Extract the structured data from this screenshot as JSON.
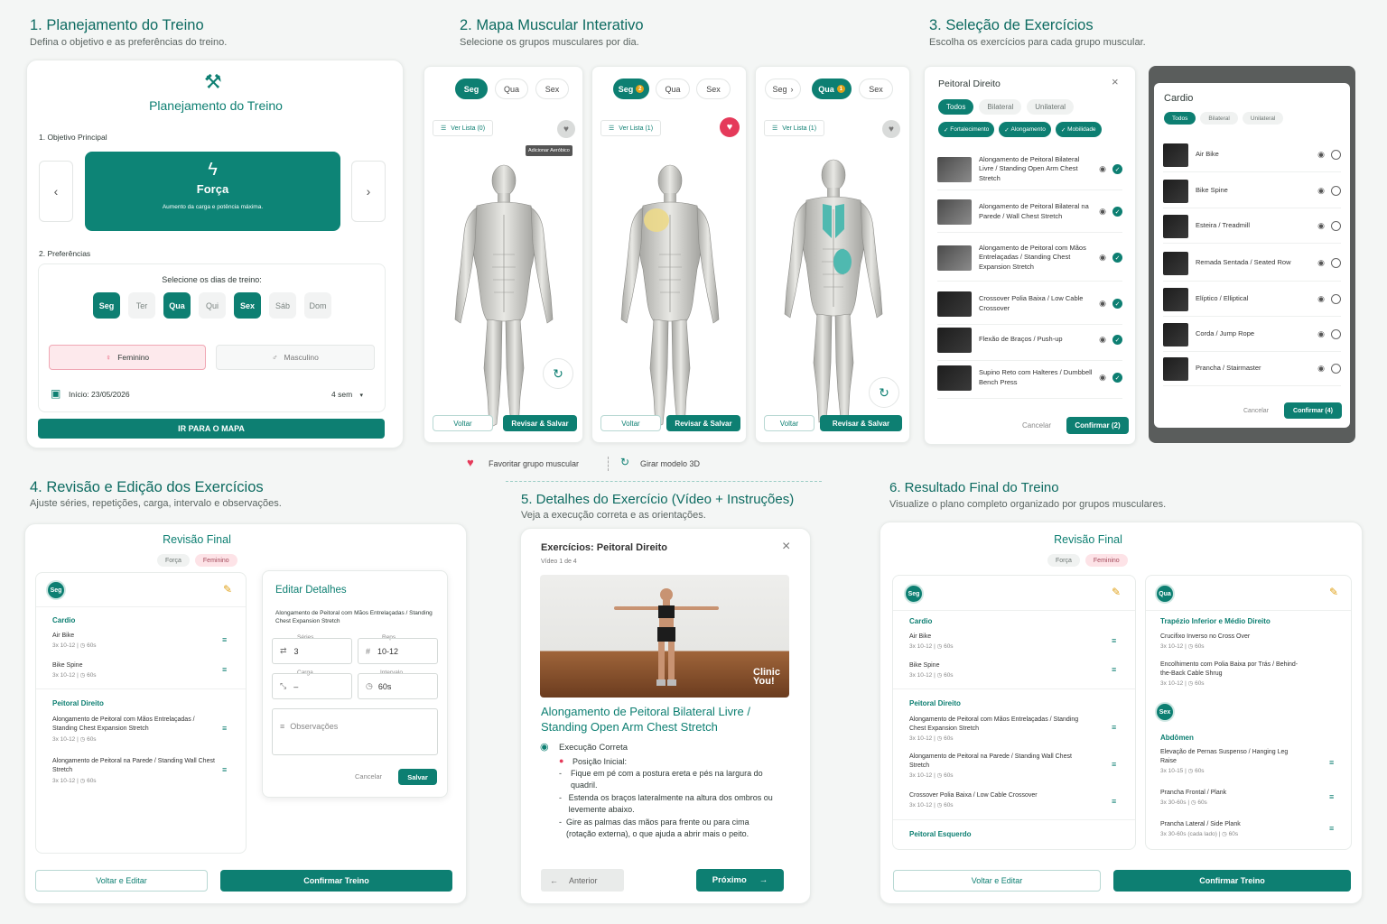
{
  "s1": {
    "title": "1. Planejamento do Treino",
    "sub": "Defina o objetivo e as preferências do treino.",
    "card_title": "Planejamento do Treino",
    "obj_label": "1. Objetivo Principal",
    "goal": "Força",
    "goal_desc": "Aumento da carga e potência máxima.",
    "pref_label": "2. Preferências",
    "days_label": "Selecione os dias de treino:",
    "days": [
      {
        "l": "Seg",
        "on": true
      },
      {
        "l": "Ter",
        "on": false
      },
      {
        "l": "Qua",
        "on": true
      },
      {
        "l": "Qui",
        "on": false
      },
      {
        "l": "Sex",
        "on": true
      },
      {
        "l": "Sáb",
        "on": false
      },
      {
        "l": "Dom",
        "on": false
      }
    ],
    "female": "Feminino",
    "male": "Masculino",
    "start": "Início: 23/05/2026",
    "weeks": "4 sem",
    "cta": "IR PARA O MAPA"
  },
  "s2": {
    "title": "2. Mapa Muscular Interativo",
    "sub": "Selecione os grupos musculares por dia.",
    "tabs": [
      "Seg",
      "Qua",
      "Sex"
    ],
    "list0": "Ver Lista (0)",
    "list1": "Ver Lista (1)",
    "list2": "Ver Lista (1)",
    "tooltip": "Adicionar Aeróbico",
    "back": "Voltar",
    "save": "Revisar & Salvar",
    "legend_fav": "Favoritar grupo muscular",
    "legend_rot": "Girar modelo 3D",
    "badge1": "2",
    "badge2": "1"
  },
  "s3": {
    "title": "3. Seleção de Exercícios",
    "sub": "Escolha os exercícios para cada grupo muscular.",
    "p1": {
      "title": "Peitoral Direito",
      "filters": [
        "Todos",
        "Bilateral",
        "Unilateral"
      ],
      "tags": [
        "Fortalecimento",
        "Alongamento",
        "Mobilidade"
      ],
      "items": [
        "Alongamento de Peitoral Bilateral Livre / Standing Open Arm Chest Stretch",
        "Alongamento de Peitoral Bilateral na Parede / Wall Chest Stretch",
        "Alongamento de Peitoral com Mãos Entrelaçadas / Standing Chest Expansion Stretch",
        "Crossover Polia Baixa / Low Cable Crossover",
        "Flexão de Braços / Push-up",
        "Supino Reto com Halteres / Dumbbell Bench Press"
      ],
      "cancel": "Cancelar",
      "confirm": "Confirmar (2)"
    },
    "p2": {
      "title": "Cardio",
      "filters": [
        "Todos",
        "Bilateral",
        "Unilateral"
      ],
      "items": [
        "Air Bike",
        "Bike Spine",
        "Esteira / Treadmill",
        "Remada Sentada / Seated Row",
        "Elíptico / Elliptical",
        "Corda / Jump Rope",
        "Prancha / Stairmaster"
      ],
      "cancel": "Cancelar",
      "confirm": "Confirmar (4)"
    }
  },
  "s4": {
    "title": "4. Revisão e Edição dos Exercícios",
    "sub": "Ajuste séries, repetições, carga, intervalo e observações.",
    "card_title": "Revisão Final",
    "tags": [
      "Força",
      "Feminino"
    ],
    "day": "Seg",
    "g1": "Cardio",
    "i1": "Air Bike",
    "m1": "3x 10-12 | ◷ 60s",
    "i2": "Bike Spine",
    "m2": "3x 10-12 | ◷ 60s",
    "g2": "Peitoral Direito",
    "i3": "Alongamento de Peitoral com Mãos Entrelaçadas / Standing Chest Expansion Stretch",
    "m3": "3x 10-12 | ◷ 60s",
    "i4": "Alongamento de Peitoral na Parede / Standing Wall Chest Stretch",
    "m4": "3x 10-12 | ◷ 60s",
    "edit": {
      "title": "Editar Detalhes",
      "name": "Alongamento de Peitoral com Mãos Entrelaçadas / Standing Chest Expansion Stretch",
      "l_series": "Séries",
      "v_series": "3",
      "l_reps": "Reps",
      "v_reps": "10-12",
      "l_load": "Carga",
      "v_load": "–",
      "l_int": "Intervalo",
      "v_int": "60s",
      "obs": "Observações",
      "cancel": "Cancelar",
      "save": "Salvar"
    },
    "back": "Voltar e Editar",
    "confirm": "Confirmar Treino"
  },
  "s5": {
    "title": "5. Detalhes do Exercício (Vídeo + Instruções)",
    "sub": "Veja a execução correta e as orientações.",
    "head": "Exercícios: Peitoral Direito",
    "count": "Vídeo 1 de 4",
    "brand": "Clinic You!",
    "ex": "Alongamento de Peitoral Bilateral Livre / Standing Open Arm Chest Stretch",
    "exec": "Execução Correta",
    "pos": "Posição Inicial:",
    "b1": "Fique em pé com a postura ereta e pés na largura do quadril.",
    "b2": "Estenda os braços lateralmente na altura dos ombros ou levemente abaixo.",
    "b3": "Gire as palmas das mãos para frente ou para cima (rotação externa), o que ajuda a abrir mais o peito.",
    "prev": "Anterior",
    "next": "Próximo"
  },
  "s6": {
    "title": "6. Resultado Final do Treino",
    "sub": "Visualize o plano completo organizado por grupos musculares.",
    "card_title": "Revisão Final",
    "tags": [
      "Força",
      "Feminino"
    ],
    "c1": {
      "day": "Seg",
      "g1": "Cardio",
      "i1": "Air Bike",
      "m1": "3x 10-12 | ◷ 60s",
      "i2": "Bike Spine",
      "m2": "3x 10-12 | ◷ 60s",
      "g2": "Peitoral Direito",
      "i3": "Alongamento de Peitoral com Mãos Entrelaçadas / Standing Chest Expansion Stretch",
      "m3": "3x 10-12 | ◷ 60s",
      "i4": "Alongamento de Peitoral na Parede / Standing Wall Chest Stretch",
      "m4": "3x 10-12 | ◷ 60s",
      "i5": "Crossover Polia Baixa / Low Cable Crossover",
      "m5": "3x 10-12 | ◷ 60s",
      "g3": "Peitoral Esquerdo"
    },
    "c2": {
      "day": "Qua",
      "g1": "Trapézio Inferior e Médio Direito",
      "i1": "Crucifixo Inverso no Cross Over",
      "m1": "3x 10-12 | ◷ 60s",
      "i2": "Encolhimento com Polia Baixa por Trás / Behind-the-Back Cable Shrug",
      "m2": "3x 10-12 | ◷ 60s",
      "day2": "Sex",
      "g2": "Abdômen",
      "i3": "Elevação de Pernas Suspenso / Hanging Leg Raise",
      "m3": "3x 10-15 | ◷ 60s",
      "i4": "Prancha Frontal / Plank",
      "m4": "3x 30-60s | ◷ 60s",
      "i5": "Prancha Lateral / Side Plank",
      "m5": "3x 30-60s (cada lado) | ◷ 60s"
    },
    "back": "Voltar e Editar",
    "confirm": "Confirmar Treino"
  },
  "colors": {
    "teal": "#0d7f72",
    "heart": "#e53a5a",
    "pencil": "#e0a21a"
  }
}
